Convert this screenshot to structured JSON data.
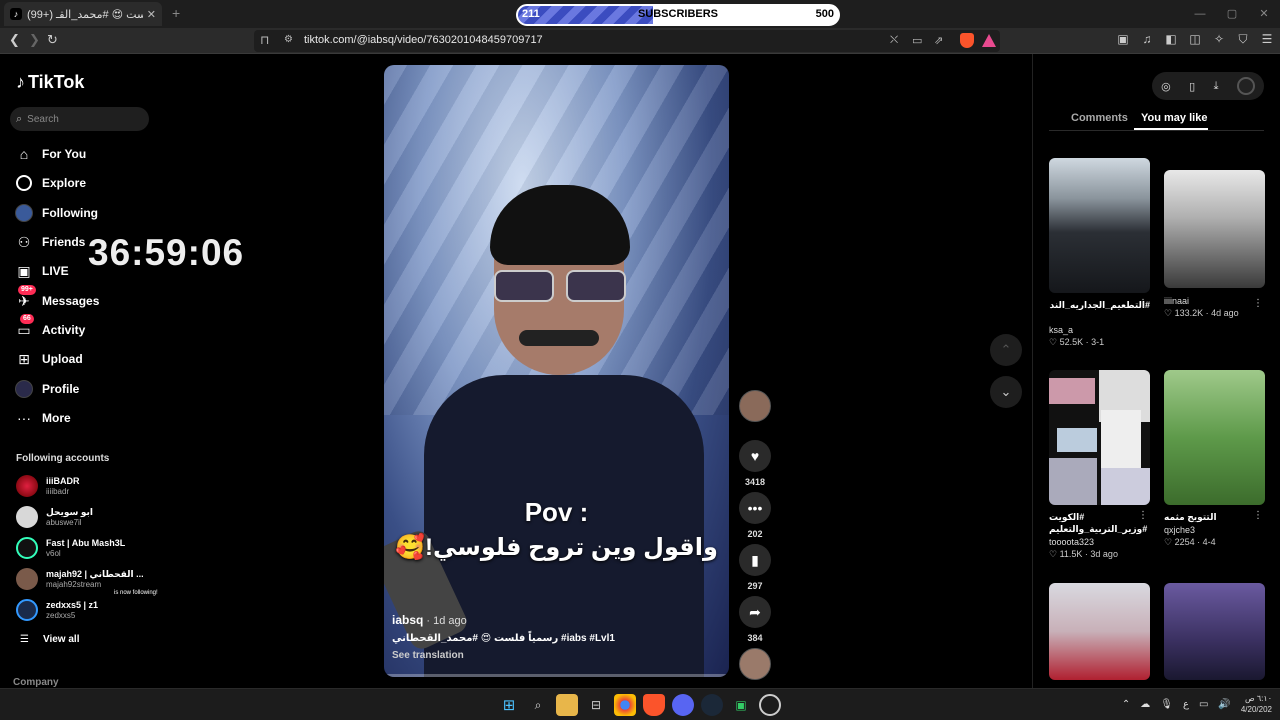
{
  "browser": {
    "tab_title": "(99+) رسمياً فلست 😍 #محمد_القـ",
    "tab_close": "✕",
    "new_tab": "+",
    "url": "tiktok.com/@iabsq/video/7630201048459709717",
    "win_min": "—",
    "win_max": "▢",
    "win_close": "✕"
  },
  "subscribers": {
    "current": "211",
    "label": "SUBSCRIBERS",
    "goal": "500",
    "progress": 0.422
  },
  "tiktok": {
    "logo": "TikTok",
    "search_placeholder": "Search",
    "nav": {
      "for_you": "For You",
      "explore": "Explore",
      "following": "Following",
      "friends": "Friends",
      "live": "LIVE",
      "messages": "Messages",
      "messages_badge": "99+",
      "activity": "Activity",
      "activity_badge": "66",
      "upload": "Upload",
      "profile": "Profile",
      "more": "More"
    },
    "following_accounts_title": "Following accounts",
    "accounts": [
      {
        "name": "iiiBADR",
        "handle": "iiiibadr"
      },
      {
        "name": "ابو سويحل",
        "handle": "abuswe7il"
      },
      {
        "name": "Fast | Abu Mash3L",
        "handle": "v6ol"
      },
      {
        "name": "majah92 | القحطاني ...",
        "handle": "majah92stream"
      },
      {
        "name": "zedxxs5 | z1",
        "handle": "zedxxs5"
      }
    ],
    "now_following": "is now following!",
    "view_all": "View all",
    "company": "Company"
  },
  "overlay": {
    "timer": "36:59:06"
  },
  "video": {
    "pov": "Pov :",
    "arabic_text": "واقول وين تروح فلوسي!🥰",
    "author": "iabsq",
    "date": " · 1d ago",
    "caption": "رسمياً فلست 😍 #محمد_القحطاني #iabs #Lvl1",
    "see_translation": "See translation"
  },
  "actions": {
    "likes": "3418",
    "comments": "202",
    "saves": "297",
    "shares": "384"
  },
  "right_panel": {
    "tab_comments": "Comments",
    "tab_you_may_like": "You may like",
    "cards": [
      {
        "title": "#التطعيم_الجداريه_الندوه_شرق_الرياض",
        "user": "ksa_a",
        "stats": "♡ 52.5K · 3-1"
      },
      {
        "title": "",
        "user": "iiiinaai",
        "stats": "♡ 133.2K · 4d ago"
      },
      {
        "title": "#الكويت #وزير_التربية_والتعليم",
        "user": "toooota323",
        "stats": "♡ 11.5K · 3d ago"
      },
      {
        "title": "التتويج مثمه ههههههههههههه...",
        "user": "qxjche3",
        "stats": "♡ 2254 · 4-4"
      }
    ]
  },
  "taskbar": {
    "time": "٦:١٠ ص",
    "date": "4/20/202",
    "lang": "ع"
  }
}
